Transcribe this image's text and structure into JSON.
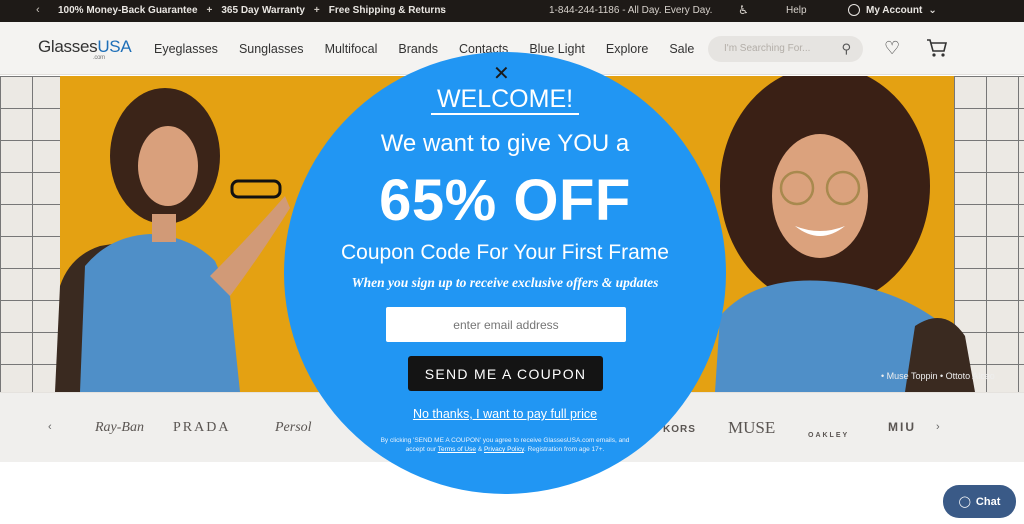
{
  "topbar": {
    "benefits": [
      "100% Money-Back Guarantee",
      "365 Day Warranty",
      "Free Shipping & Returns"
    ],
    "separator": "+",
    "phone": "1-844-244-1186 - All Day. Every Day.",
    "help": "Help",
    "account": "My Account"
  },
  "header": {
    "logo_main": "Glasses",
    "logo_accent": "USA",
    "logo_sub": ".com",
    "nav": [
      "Eyeglasses",
      "Sunglasses",
      "Multifocal",
      "Brands",
      "Contacts",
      "Blue Light",
      "Explore",
      "Sale"
    ],
    "search_placeholder": "I'm Searching For..."
  },
  "hero": {
    "credit": "• Muse Toppin • Ottoto Alceo"
  },
  "brands": [
    "Ray-Ban",
    "PRADA",
    "Persol",
    "KORS",
    "MUSE",
    "OAKLEY",
    "MIU"
  ],
  "chat": {
    "label": "Chat"
  },
  "modal": {
    "close": "✕",
    "welcome": "WELCOME!",
    "line1": "We want to give YOU a",
    "headline": "65% OFF",
    "line2": "Coupon Code For Your First Frame",
    "subline": "When you sign up to receive exclusive offers & updates",
    "email_placeholder": "enter email address",
    "send_button": "SEND ME A COUPON",
    "decline": "No thanks, I want to pay full price",
    "fine_part1": "By clicking 'SEND ME A COUPON' you agree to receive GlassesUSA.com emails, and accept our",
    "terms": "Terms of Use",
    "amp": "&",
    "privacy": "Privacy Policy",
    "fine_part2": ". Registration from age 17+."
  },
  "colors": {
    "modal_bg": "#2196f3",
    "topbar_bg": "#1e1a17",
    "hero_yellow": "#e4a112",
    "chat_bg": "#3a5a87"
  }
}
